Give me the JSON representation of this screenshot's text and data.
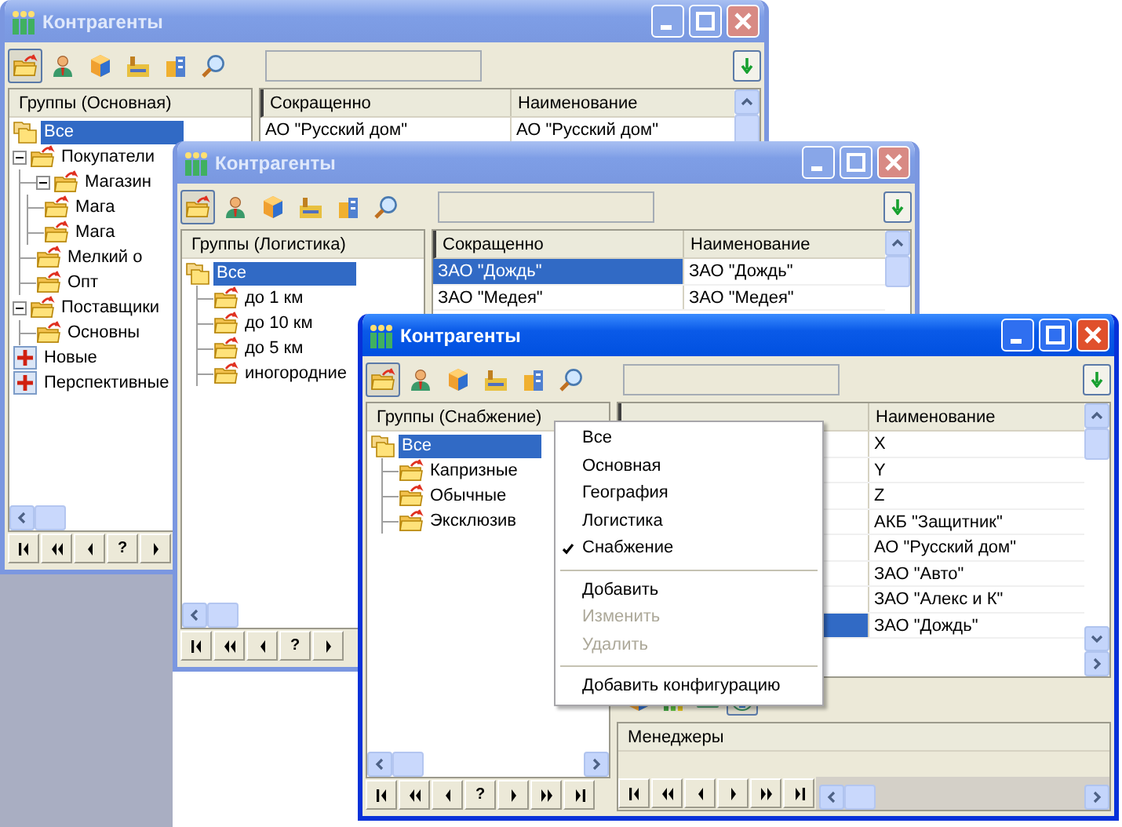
{
  "windows": [
    {
      "title": "Контрагенты",
      "active": false,
      "toolbar": [
        {
          "kind": "folder",
          "selected": true
        },
        {
          "kind": "person",
          "selected": false
        },
        {
          "kind": "cube",
          "selected": false
        },
        {
          "kind": "factory",
          "selected": false
        },
        {
          "kind": "buildings",
          "selected": false
        },
        {
          "kind": "search",
          "selected": false
        }
      ],
      "tree": {
        "header": "Группы (Основная)",
        "items": [
          {
            "label": "Все",
            "kind": "all",
            "selected": true
          },
          {
            "label": "Покупатели",
            "kind": "folder",
            "selected": false,
            "expanded": true,
            "children": [
              {
                "label": "Магазин",
                "kind": "folder",
                "selected": false,
                "expanded": true,
                "children": [
                  {
                    "label": "Мага",
                    "kind": "folder",
                    "selected": false
                  },
                  {
                    "label": "Мага",
                    "kind": "folder",
                    "selected": false
                  }
                ]
              },
              {
                "label": "Мелкий о",
                "kind": "folder",
                "selected": false
              },
              {
                "label": "Опт",
                "kind": "folder",
                "selected": false
              }
            ]
          },
          {
            "label": "Поставщики",
            "kind": "folder",
            "selected": false,
            "expanded": true,
            "children": [
              {
                "label": "Основны",
                "kind": "folder",
                "selected": false
              }
            ]
          },
          {
            "label": "Новые",
            "kind": "plus",
            "selected": false
          },
          {
            "label": "Перспективные",
            "kind": "plus",
            "selected": false
          }
        ]
      },
      "grid": {
        "columns": [
          "Сокращенно",
          "Наименование"
        ],
        "rows": [
          {
            "short": "АО \"Русский дом\"",
            "name": "АО \"Русский дом\"",
            "selected": false
          }
        ]
      },
      "nav": [
        {
          "kind": "first"
        },
        {
          "kind": "prev-page"
        },
        {
          "kind": "prev"
        },
        {
          "kind": "help",
          "label": "?"
        },
        {
          "kind": "next"
        }
      ]
    },
    {
      "title": "Контрагенты",
      "active": false,
      "toolbar": [
        {
          "kind": "folder",
          "selected": true
        },
        {
          "kind": "person",
          "selected": false
        },
        {
          "kind": "cube",
          "selected": false
        },
        {
          "kind": "factory",
          "selected": false
        },
        {
          "kind": "buildings",
          "selected": false
        },
        {
          "kind": "search",
          "selected": false
        }
      ],
      "tree": {
        "header": "Группы (Логистика)",
        "items": [
          {
            "label": "Все",
            "kind": "all",
            "selected": true,
            "children": [
              {
                "label": "до 1 км",
                "kind": "folder",
                "selected": false
              },
              {
                "label": "до 10 км",
                "kind": "folder",
                "selected": false
              },
              {
                "label": "до 5 км",
                "kind": "folder",
                "selected": false
              },
              {
                "label": "иногородние",
                "kind": "folder",
                "selected": false
              }
            ]
          }
        ]
      },
      "grid": {
        "columns": [
          "Сокращенно",
          "Наименование"
        ],
        "rows": [
          {
            "short": "ЗАО \"Дождь\"",
            "name": "ЗАО \"Дождь\"",
            "selected": true
          },
          {
            "short": "ЗАО \"Медея\"",
            "name": "ЗАО \"Медея\"",
            "selected": false
          }
        ]
      },
      "nav": [
        {
          "kind": "first"
        },
        {
          "kind": "prev-page"
        },
        {
          "kind": "prev"
        },
        {
          "kind": "help",
          "label": "?"
        },
        {
          "kind": "next"
        }
      ]
    },
    {
      "title": "Контрагенты",
      "active": true,
      "toolbar": [
        {
          "kind": "folder",
          "selected": true
        },
        {
          "kind": "person",
          "selected": false
        },
        {
          "kind": "cube",
          "selected": false
        },
        {
          "kind": "factory",
          "selected": false
        },
        {
          "kind": "buildings",
          "selected": false
        },
        {
          "kind": "search",
          "selected": false
        }
      ],
      "tree": {
        "header": "Группы (Снабжение)",
        "items": [
          {
            "label": "Все",
            "kind": "all",
            "selected": true,
            "children": [
              {
                "label": "Капризные",
                "kind": "folder",
                "selected": false
              },
              {
                "label": "Обычные",
                "kind": "folder",
                "selected": false
              },
              {
                "label": "Эксклюзив",
                "kind": "folder",
                "selected": false
              }
            ]
          }
        ]
      },
      "grid": {
        "columns": [
          "Наименование"
        ],
        "rows": [
          {
            "name": "X",
            "selected": false
          },
          {
            "name": "Y",
            "selected": false
          },
          {
            "name": "Z",
            "selected": false
          },
          {
            "name": "АКБ \"Защитник\"",
            "selected": false
          },
          {
            "name": "АО \"Русский дом\"",
            "selected": false
          },
          {
            "name": "ЗАО \"Авто\"",
            "selected": false
          },
          {
            "name": "ЗАО \"Алекс и К\"",
            "selected": false
          },
          {
            "name": "ЗАО \"Дождь\"",
            "selected": true
          }
        ]
      },
      "nav": [
        {
          "kind": "first"
        },
        {
          "kind": "prev-page"
        },
        {
          "kind": "prev"
        },
        {
          "kind": "help",
          "label": "?"
        },
        {
          "kind": "next"
        },
        {
          "kind": "next-page"
        },
        {
          "kind": "last"
        }
      ],
      "details": {
        "toolbar": [
          {
            "kind": "cube",
            "selected": false
          },
          {
            "kind": "chart",
            "selected": false
          },
          {
            "kind": "card",
            "selected": false
          },
          {
            "kind": "emblem",
            "selected": true
          }
        ],
        "header": "Менеджеры",
        "nav": [
          {
            "kind": "first"
          },
          {
            "kind": "prev-page"
          },
          {
            "kind": "prev"
          },
          {
            "kind": "next"
          },
          {
            "kind": "next-page"
          },
          {
            "kind": "last"
          }
        ]
      }
    }
  ],
  "menu": {
    "items": [
      {
        "kind": "item",
        "label": "Все",
        "checked": false,
        "disabled": false
      },
      {
        "kind": "item",
        "label": "Основная",
        "checked": false,
        "disabled": false
      },
      {
        "kind": "item",
        "label": "География",
        "checked": false,
        "disabled": false
      },
      {
        "kind": "item",
        "label": "Логистика",
        "checked": false,
        "disabled": false
      },
      {
        "kind": "item",
        "label": "Снабжение",
        "checked": true,
        "disabled": false
      },
      {
        "kind": "separator"
      },
      {
        "kind": "item",
        "label": "Добавить",
        "checked": false,
        "disabled": false
      },
      {
        "kind": "item",
        "label": "Изменить",
        "checked": false,
        "disabled": true
      },
      {
        "kind": "item",
        "label": "Удалить",
        "checked": false,
        "disabled": true
      },
      {
        "kind": "separator"
      },
      {
        "kind": "item",
        "label": "Добавить конфигурацию",
        "checked": false,
        "disabled": false
      }
    ]
  }
}
